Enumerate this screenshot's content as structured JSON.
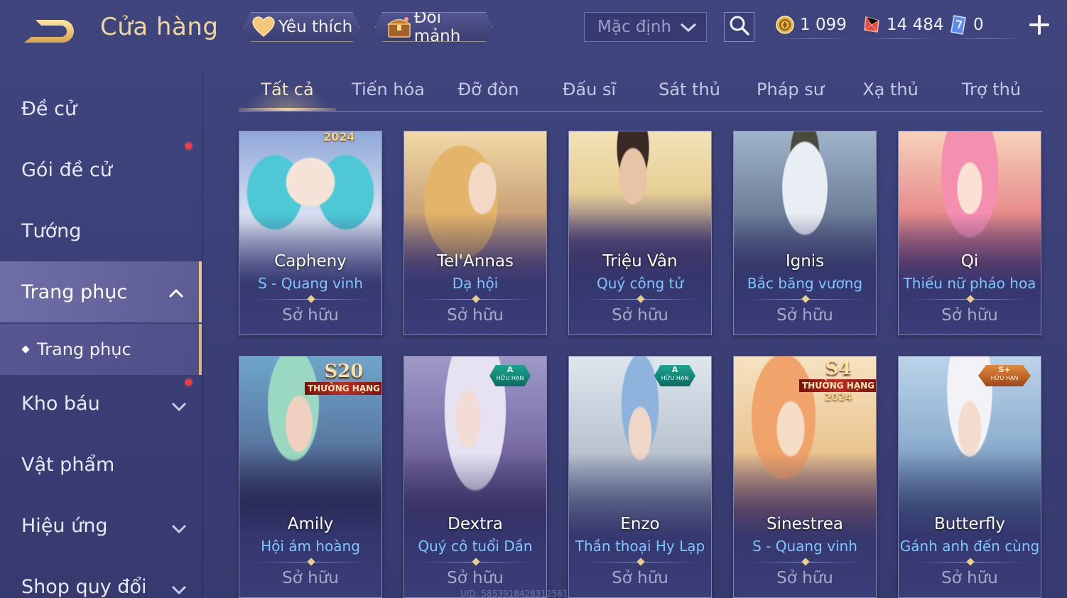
{
  "header": {
    "title": "Cửa hàng",
    "favorites_label": "Yêu thích",
    "exchange_label": "Đổi mảnh",
    "sort_value": "Mặc định",
    "currencies": [
      {
        "name": "coin",
        "value": "1 099"
      },
      {
        "name": "gem",
        "value": "14 484"
      },
      {
        "name": "ticket",
        "value": "0"
      }
    ]
  },
  "sidebar": {
    "items": [
      {
        "label": "Đề cử"
      },
      {
        "label": "Gói đề cử"
      },
      {
        "label": "Tướng"
      },
      {
        "label": "Trang phục"
      },
      {
        "label": "Kho báu"
      },
      {
        "label": "Vật phẩm"
      },
      {
        "label": "Hiệu ứng"
      },
      {
        "label": "Shop quy đổi"
      }
    ],
    "sub_item": "Trang phục"
  },
  "tabs": [
    "Tất cả",
    "Tiến hóa",
    "Đỡ đòn",
    "Đấu sĩ",
    "Sát thủ",
    "Pháp sư",
    "Xạ thủ",
    "Trợ thủ"
  ],
  "active_tab": "Tất cả",
  "cards": [
    {
      "hero": "Capheny",
      "skin": "S - Quang vinh",
      "status": "Sở hữu",
      "badge": "2024"
    },
    {
      "hero": "Tel'Annas",
      "skin": "Dạ hội",
      "status": "Sở hữu"
    },
    {
      "hero": "Triệu Vân",
      "skin": "Quý công tử",
      "status": "Sở hữu"
    },
    {
      "hero": "Ignis",
      "skin": "Bắc băng vương",
      "status": "Sở hữu"
    },
    {
      "hero": "Qi",
      "skin": "Thiếu nữ pháo hoa",
      "status": "Sở hữu"
    },
    {
      "hero": "Amily",
      "skin": "Hội ám hoàng",
      "status": "Sở hữu",
      "badge": "S20",
      "badge_sub": "THƯỞNG HẠNG"
    },
    {
      "hero": "Dextra",
      "skin": "Quý cô tuổi Dần",
      "status": "Sở hữu",
      "badge": "A",
      "badge_sub": "HỮU HẠN"
    },
    {
      "hero": "Enzo",
      "skin": "Thần thoại Hy Lạp",
      "status": "Sở hữu",
      "badge": "A",
      "badge_sub": "HỮU HẠN"
    },
    {
      "hero": "Sinestrea",
      "skin": "S - Quang vinh",
      "status": "Sở hữu",
      "badge": "S4",
      "badge_sub": "THƯỞNG HẠNG",
      "badge_year": "2024"
    },
    {
      "hero": "Butterfly",
      "skin": "Gánh anh đến cùng",
      "status": "Sở hữu",
      "badge": "S+",
      "badge_sub": "HỮU HẠN"
    }
  ],
  "footer": {
    "uid": "UID: 5853918428312561"
  },
  "colors": {
    "accent": "#f0d79a",
    "skin_text": "#7fc6ff",
    "notification": "#ff3a3a"
  }
}
